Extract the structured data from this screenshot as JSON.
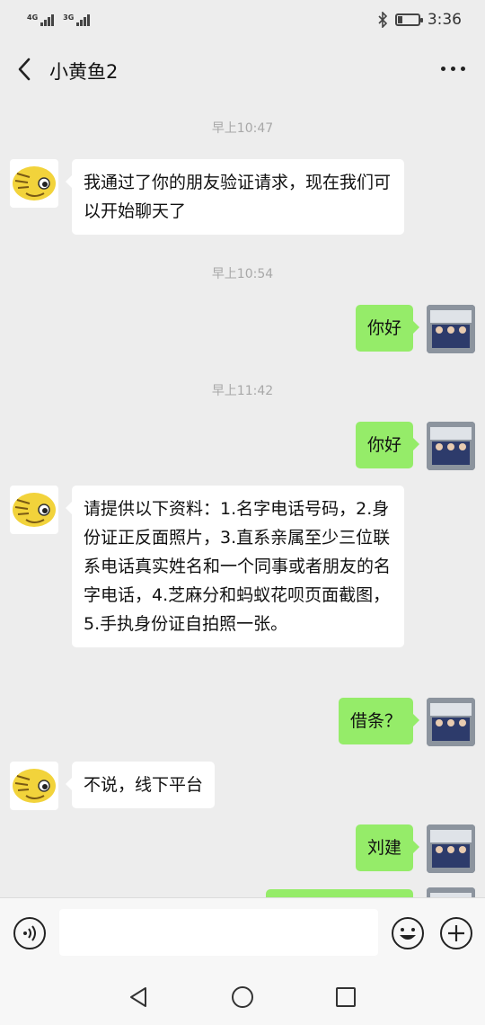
{
  "status_bar": {
    "signal1_label": "4G",
    "signal2_label": "3G",
    "time": "3:36",
    "battery_level": 0.25,
    "icons": [
      "bluetooth-icon",
      "battery-icon"
    ]
  },
  "header": {
    "title": "小黄鱼2",
    "icons": [
      "back-icon",
      "more-icon"
    ]
  },
  "messages": [
    {
      "type": "timestamp",
      "text": "早上10:47"
    },
    {
      "type": "received",
      "text": "我通过了你的朋友验证请求，现在我们可以开始聊天了"
    },
    {
      "type": "timestamp",
      "text": "早上10:54"
    },
    {
      "type": "sent",
      "text": "你好"
    },
    {
      "type": "timestamp",
      "text": "早上11:42"
    },
    {
      "type": "sent",
      "text": "你好"
    },
    {
      "type": "received",
      "text": "请提供以下资料：1.名字电话号码，2.身份证正反面照片，3.直系亲属至少三位联系电话真实姓名和一个同事或者朋友的名字电话，4.芝麻分和蚂蚁花呗页面截图，5.手执身份证自拍照一张。"
    },
    {
      "type": "sent",
      "text": "借条？"
    },
    {
      "type": "received",
      "text": "不说，线下平台"
    },
    {
      "type": "sent",
      "text": "刘建"
    }
  ],
  "colors": {
    "background": "#ededed",
    "sent_bubble": "#95ec69",
    "received_bubble": "#ffffff",
    "timestamp": "#a8a8a8"
  },
  "input_bar": {
    "icons": [
      "voice-icon",
      "emoji-icon",
      "plus-icon"
    ],
    "value": ""
  },
  "nav_bar": {
    "icons": [
      "back-triangle-icon",
      "home-circle-icon",
      "recents-square-icon"
    ]
  }
}
